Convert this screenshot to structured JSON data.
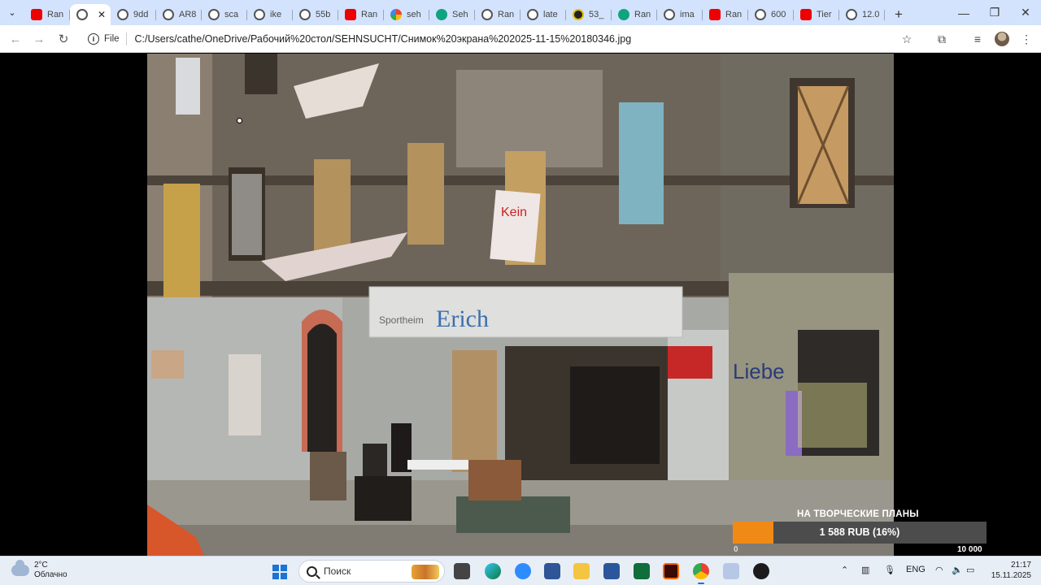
{
  "tabs": [
    {
      "icon": "youtube-icon",
      "label": "Ran"
    },
    {
      "icon": "globe-icon",
      "label": "",
      "active": true
    },
    {
      "icon": "globe-icon",
      "label": "9dd"
    },
    {
      "icon": "globe-icon",
      "label": "AR8"
    },
    {
      "icon": "globe-icon",
      "label": "sca"
    },
    {
      "icon": "globe-icon",
      "label": "ike"
    },
    {
      "icon": "globe-icon",
      "label": "55b"
    },
    {
      "icon": "youtube-icon",
      "label": "Ran"
    },
    {
      "icon": "google-icon",
      "label": "seh"
    },
    {
      "icon": "chatgpt-icon",
      "label": "Seh"
    },
    {
      "icon": "globe-icon",
      "label": "Ran"
    },
    {
      "icon": "globe-icon",
      "label": "late"
    },
    {
      "icon": "app-icon",
      "label": "53_"
    },
    {
      "icon": "chatgpt-icon",
      "label": "Ran"
    },
    {
      "icon": "globe-icon",
      "label": "ima"
    },
    {
      "icon": "youtube-icon",
      "label": "Ran"
    },
    {
      "icon": "globe-icon",
      "label": "600"
    },
    {
      "icon": "youtube-icon",
      "label": "Tier"
    },
    {
      "icon": "globe-icon",
      "label": "12.0"
    }
  ],
  "tab_close_glyph": "✕",
  "new_tab_glyph": "+",
  "address": {
    "scheme_label": "File",
    "url": "C:/Users/cathe/OneDrive/Рабочий%20стол/SEHNSUCHT/Снимок%20экрана%202025-11-15%20180346.jpg"
  },
  "photo": {
    "shop_sign": "Erich",
    "shop_sign_prefix": "Sportheim",
    "banner_text": "Kein"
  },
  "donation": {
    "title": "НА ТВОРЧЕСКИЕ ПЛАНЫ",
    "amount_text": "1 588 RUB (16%)",
    "progress": 0.16,
    "min_label": "0",
    "max_label": "10 000",
    "fill_color": "#f08a17"
  },
  "taskbar": {
    "weather_temp": "2°C",
    "weather_desc": "Облачно",
    "search_placeholder": "Поиск",
    "lang": "ENG",
    "time": "21:17",
    "date": "15.11.2025"
  }
}
